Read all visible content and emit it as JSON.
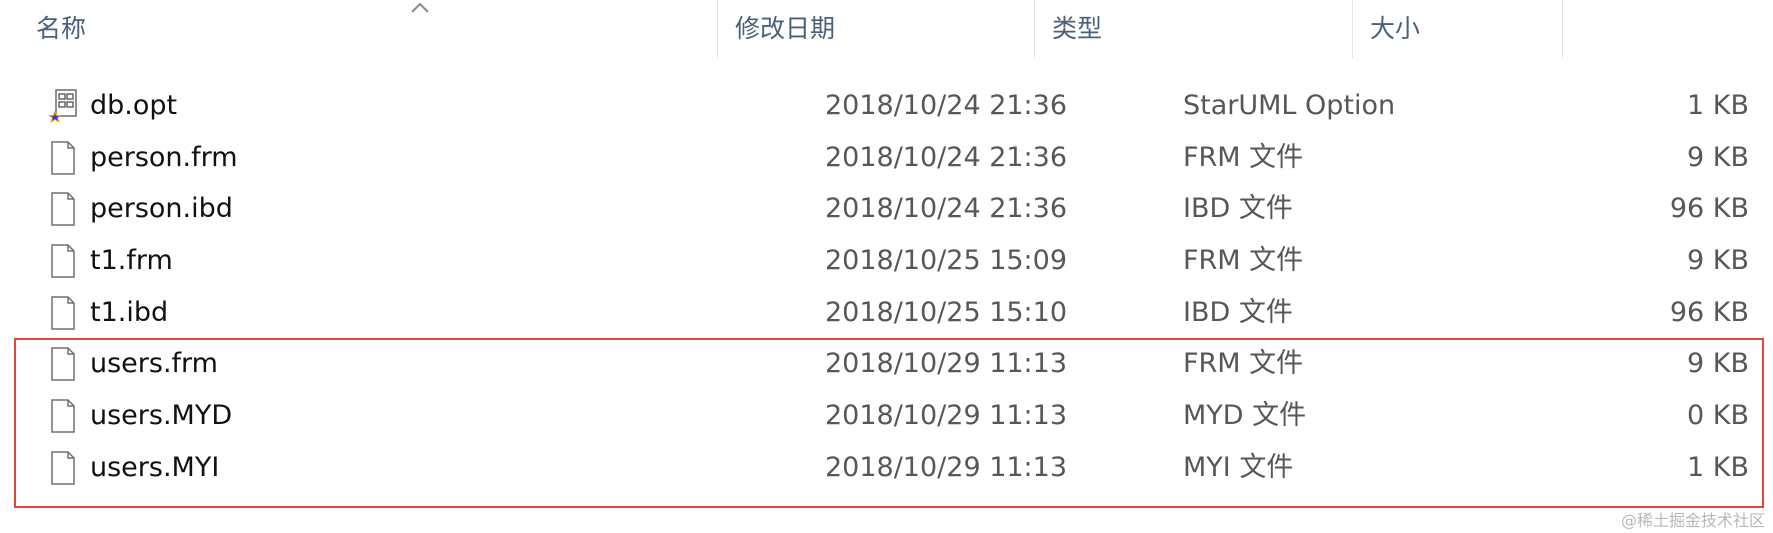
{
  "columns": {
    "name": "名称",
    "date": "修改日期",
    "type": "类型",
    "size": "大小"
  },
  "files": [
    {
      "name": "db.opt",
      "date": "2018/10/24 21:36",
      "type": "StarUML Option",
      "size": "1 KB",
      "icon": "staruml-file-icon"
    },
    {
      "name": "person.frm",
      "date": "2018/10/24 21:36",
      "type": "FRM 文件",
      "size": "9 KB",
      "icon": "blank-file-icon"
    },
    {
      "name": "person.ibd",
      "date": "2018/10/24 21:36",
      "type": "IBD 文件",
      "size": "96 KB",
      "icon": "blank-file-icon"
    },
    {
      "name": "t1.frm",
      "date": "2018/10/25 15:09",
      "type": "FRM 文件",
      "size": "9 KB",
      "icon": "blank-file-icon"
    },
    {
      "name": "t1.ibd",
      "date": "2018/10/25 15:10",
      "type": "IBD 文件",
      "size": "96 KB",
      "icon": "blank-file-icon"
    },
    {
      "name": "users.frm",
      "date": "2018/10/29 11:13",
      "type": "FRM 文件",
      "size": "9 KB",
      "icon": "blank-file-icon"
    },
    {
      "name": "users.MYD",
      "date": "2018/10/29 11:13",
      "type": "MYD 文件",
      "size": "0 KB",
      "icon": "blank-file-icon"
    },
    {
      "name": "users.MYI",
      "date": "2018/10/29 11:13",
      "type": "MYI 文件",
      "size": "1 KB",
      "icon": "blank-file-icon"
    }
  ],
  "highlight_color": "#e0463c",
  "header_text_color": "#4c607a",
  "watermark": "@稀土掘金技术社区"
}
